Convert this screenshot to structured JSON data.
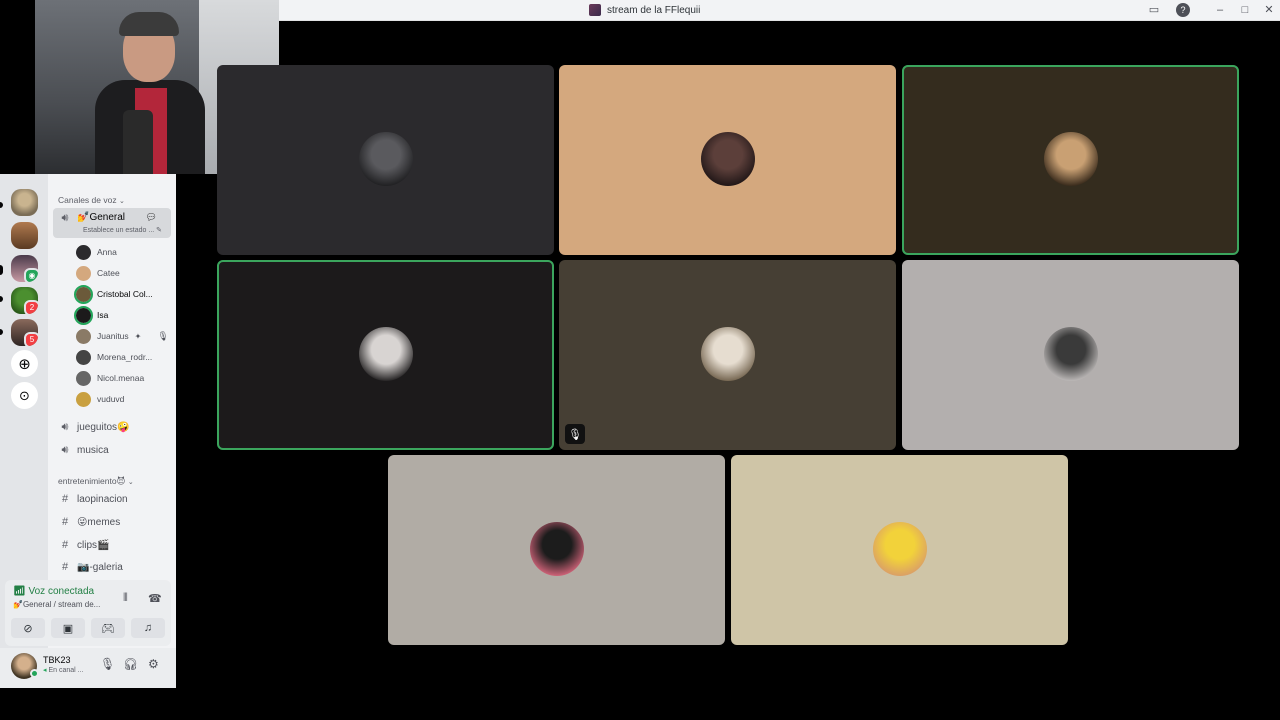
{
  "window": {
    "title": "stream de la FFlequii"
  },
  "sidebar": {
    "voice_category": "Canales de voz",
    "active_channel": {
      "name": "💅General",
      "status_hint": "Establece un estado ..."
    },
    "members": [
      {
        "name": "Anna"
      },
      {
        "name": "Catee"
      },
      {
        "name": "Cristobal Col..."
      },
      {
        "name": "Isa"
      },
      {
        "name": "Juanitus"
      },
      {
        "name": "Morena_rodr..."
      },
      {
        "name": "Nicol.menaa"
      },
      {
        "name": "vuduvd"
      }
    ],
    "voice_channels": [
      {
        "name": "jueguitos🤪"
      },
      {
        "name": "musica"
      }
    ],
    "text_category": "entretenimiento😈",
    "text_channels": [
      {
        "name": "laopinacion"
      },
      {
        "name": "😜memes"
      },
      {
        "name": "clips🎬"
      },
      {
        "name": "📷-galeria"
      }
    ],
    "servers": [
      {
        "badge": ""
      },
      {
        "badge": ""
      },
      {
        "badge": ""
      },
      {
        "badge": "2"
      },
      {
        "badge": "5"
      }
    ]
  },
  "voice_bar": {
    "status": "Voz conectada",
    "location": "💅General / stream de..."
  },
  "user_bar": {
    "username": "TBK23",
    "status": "En canal ..."
  },
  "colors": {
    "speaking_outline": "#3ba55d",
    "online": "#23a55a",
    "badge": "#f23f43"
  },
  "tiles": [
    {
      "bg": "#2b2a2d",
      "speaking": false,
      "muted": false,
      "avatar_colors": [
        "#5a5a5e",
        "#1a1a1c"
      ]
    },
    {
      "bg": "#d4a87e",
      "speaking": false,
      "muted": false,
      "avatar_colors": [
        "#5c3f3a",
        "#1a1213"
      ]
    },
    {
      "bg": "#342c1e",
      "speaking": true,
      "muted": false,
      "avatar_colors": [
        "#c9a073",
        "#2b1f13"
      ]
    },
    {
      "bg": "#1c1a1b",
      "speaking": true,
      "muted": false,
      "avatar_colors": [
        "#d8d4d2",
        "#151314"
      ]
    },
    {
      "bg": "#463f34",
      "speaking": false,
      "muted": true,
      "avatar_colors": [
        "#e6ddd0",
        "#6b5b45"
      ]
    },
    {
      "bg": "#b3afae",
      "speaking": false,
      "muted": false,
      "avatar_colors": [
        "#3a3a3a",
        "#c9c5c4"
      ]
    },
    {
      "bg": "#b1aca5",
      "speaking": false,
      "muted": false,
      "avatar_colors": [
        "#1c1c1c",
        "#e26a82"
      ]
    },
    {
      "bg": "#cfc5a7",
      "speaking": false,
      "muted": false,
      "avatar_colors": [
        "#f2d23a",
        "#d89a6b"
      ]
    }
  ]
}
